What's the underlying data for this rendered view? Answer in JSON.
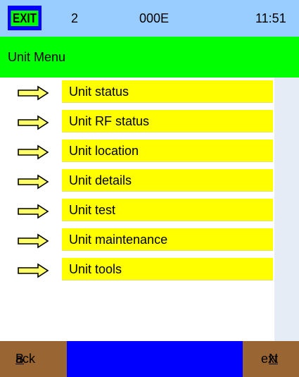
{
  "header": {
    "exit_label": "EXIT",
    "number": "2",
    "code": "000E",
    "time": "11:51"
  },
  "title": "Unit Menu",
  "menu": {
    "items": [
      {
        "label": "Unit status",
        "icon": "right-arrow-icon"
      },
      {
        "label": "Unit RF status",
        "icon": "right-arrow-icon"
      },
      {
        "label": "Unit location",
        "icon": "right-arrow-icon"
      },
      {
        "label": "Unit details",
        "icon": "right-arrow-icon"
      },
      {
        "label": "Unit test",
        "icon": "right-arrow-icon"
      },
      {
        "label": "Unit maintenance",
        "icon": "right-arrow-icon"
      },
      {
        "label": "Unit tools",
        "icon": "right-arrow-icon"
      }
    ]
  },
  "footer": {
    "back_first": "B",
    "back_rest": "ack",
    "next_first": "N",
    "next_rest": "ext"
  },
  "colors": {
    "header_bg": "#99ccff",
    "exit_bg": "#0000ff",
    "exit_text_bg": "#00ff00",
    "title_bg": "#00ff00",
    "item_bg": "#ffff00",
    "footer_bg": "#0000ff",
    "nav_button_bg": "#996633"
  }
}
